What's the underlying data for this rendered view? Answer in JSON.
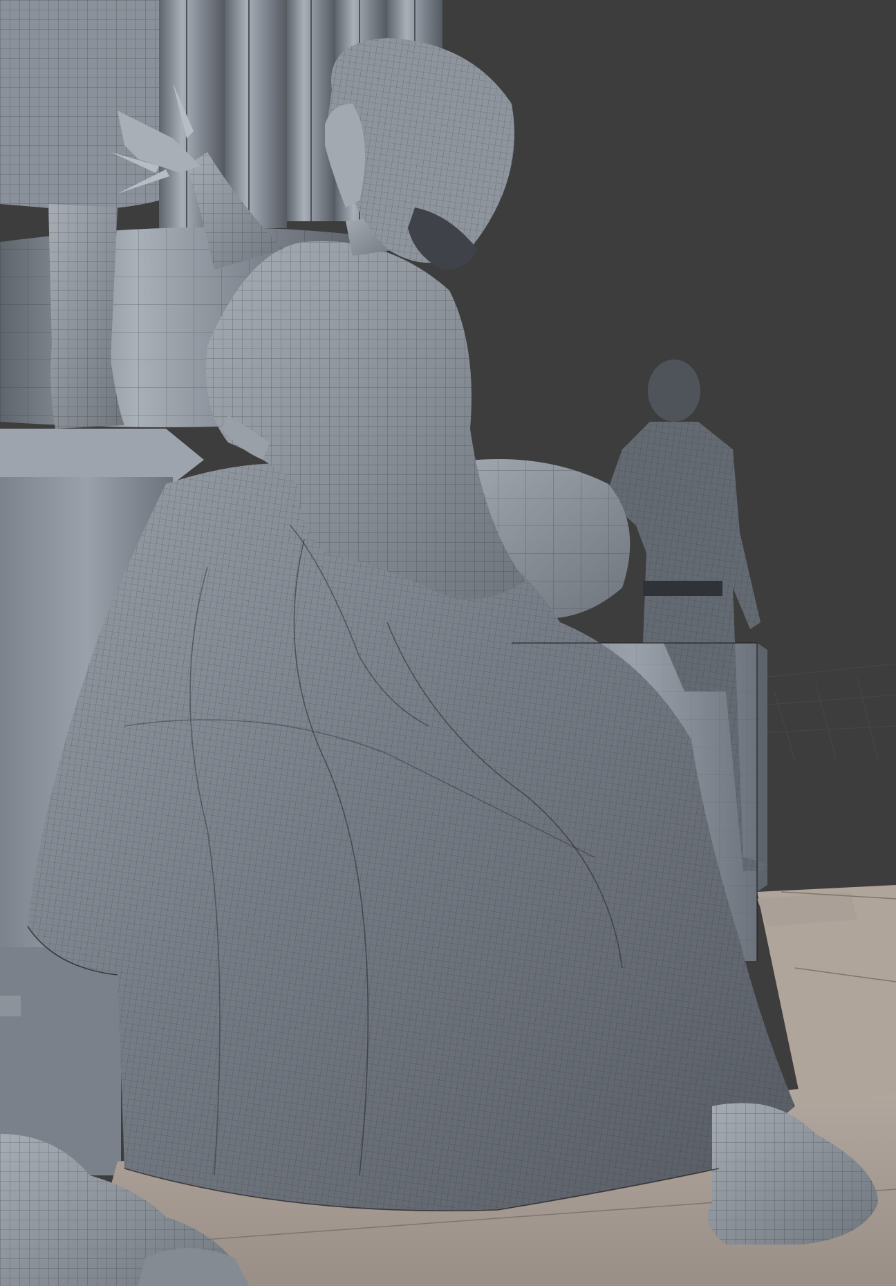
{
  "viewport": {
    "shading": "solid-with-wireframe-overlay",
    "background_color": "#3d3d3d",
    "mesh_color": "#8d939b",
    "floor_color": "#a69a91",
    "objects": [
      {
        "name": "standing-statue-legs"
      },
      {
        "name": "column-cluster"
      },
      {
        "name": "seated-woman-statue"
      },
      {
        "name": "soldier-figure"
      },
      {
        "name": "stone-pedestals"
      },
      {
        "name": "floor-slabs"
      }
    ]
  }
}
